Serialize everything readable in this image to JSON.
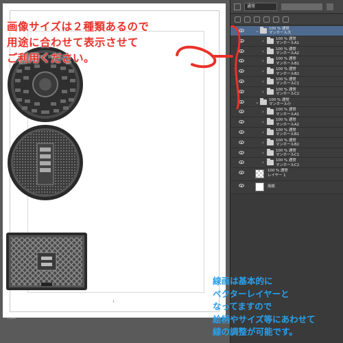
{
  "annotations": {
    "red_lines": [
      "画像サイズは２種類あるので",
      "用途に合わせて表示させて",
      "ご利用ください。"
    ],
    "blue_lines": [
      "線画は基本的に",
      "ベクターレイヤーと",
      "なってますので",
      "絵柄やサイズ等にあわせて",
      "線の調整が可能です。"
    ],
    "colors": {
      "red": "#e8322a",
      "blue": "#2aa0ec"
    }
  },
  "canvas": {
    "page_number": "1",
    "footer": "ﾏﾝﾎｰﾙ",
    "images": [
      "manhole-round-a",
      "manhole-round-b",
      "manhole-rect"
    ]
  },
  "layers_panel": {
    "blend_mode": "通常",
    "opacity_percent": 100,
    "layers": [
      {
        "name": "マンホール大",
        "mode": "100 % 通常",
        "kind": "folder",
        "selected": true
      },
      {
        "name": "マンホールA1",
        "mode": "100 % 通常",
        "kind": "folder"
      },
      {
        "name": "マンホールA2",
        "mode": "100 % 通常",
        "kind": "folder"
      },
      {
        "name": "マンホールB1",
        "mode": "100 % 通常",
        "kind": "folder"
      },
      {
        "name": "マンホールB2",
        "mode": "100 % 通常",
        "kind": "folder"
      },
      {
        "name": "マンホールC1",
        "mode": "100 % 通常",
        "kind": "folder"
      },
      {
        "name": "マンホールC2",
        "mode": "100 % 通常",
        "kind": "folder"
      },
      {
        "name": "マンホール小",
        "mode": "100 % 通常",
        "kind": "folder"
      },
      {
        "name": "マンホールA1",
        "mode": "100 % 通常",
        "kind": "folder"
      },
      {
        "name": "マンホールA2",
        "mode": "100 % 通常",
        "kind": "folder"
      },
      {
        "name": "マンホールB1",
        "mode": "100 % 通常",
        "kind": "folder"
      },
      {
        "name": "マンホールB2",
        "mode": "100 % 通常",
        "kind": "folder"
      },
      {
        "name": "マンホールC1",
        "mode": "100 % 通常",
        "kind": "folder"
      },
      {
        "name": "マンホールC2",
        "mode": "100 % 通常",
        "kind": "folder"
      },
      {
        "name": "レイヤー 1",
        "mode": "100 % 通常",
        "kind": "raster"
      },
      {
        "name": "用紙",
        "mode": "",
        "kind": "paper"
      }
    ]
  }
}
